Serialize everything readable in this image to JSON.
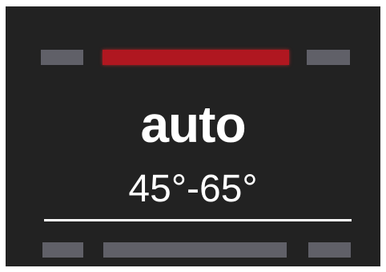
{
  "display": {
    "mode_label": "auto",
    "range_label": "45°-65°",
    "text_color": "#ffffff",
    "background_color": "#222222",
    "active_color": "#b01720",
    "inactive_color": "#606068"
  },
  "top_indicator": {
    "segments": [
      "inactive",
      "active",
      "inactive"
    ]
  },
  "bottom_indicator": {
    "segments": [
      "inactive",
      "inactive",
      "inactive"
    ]
  }
}
